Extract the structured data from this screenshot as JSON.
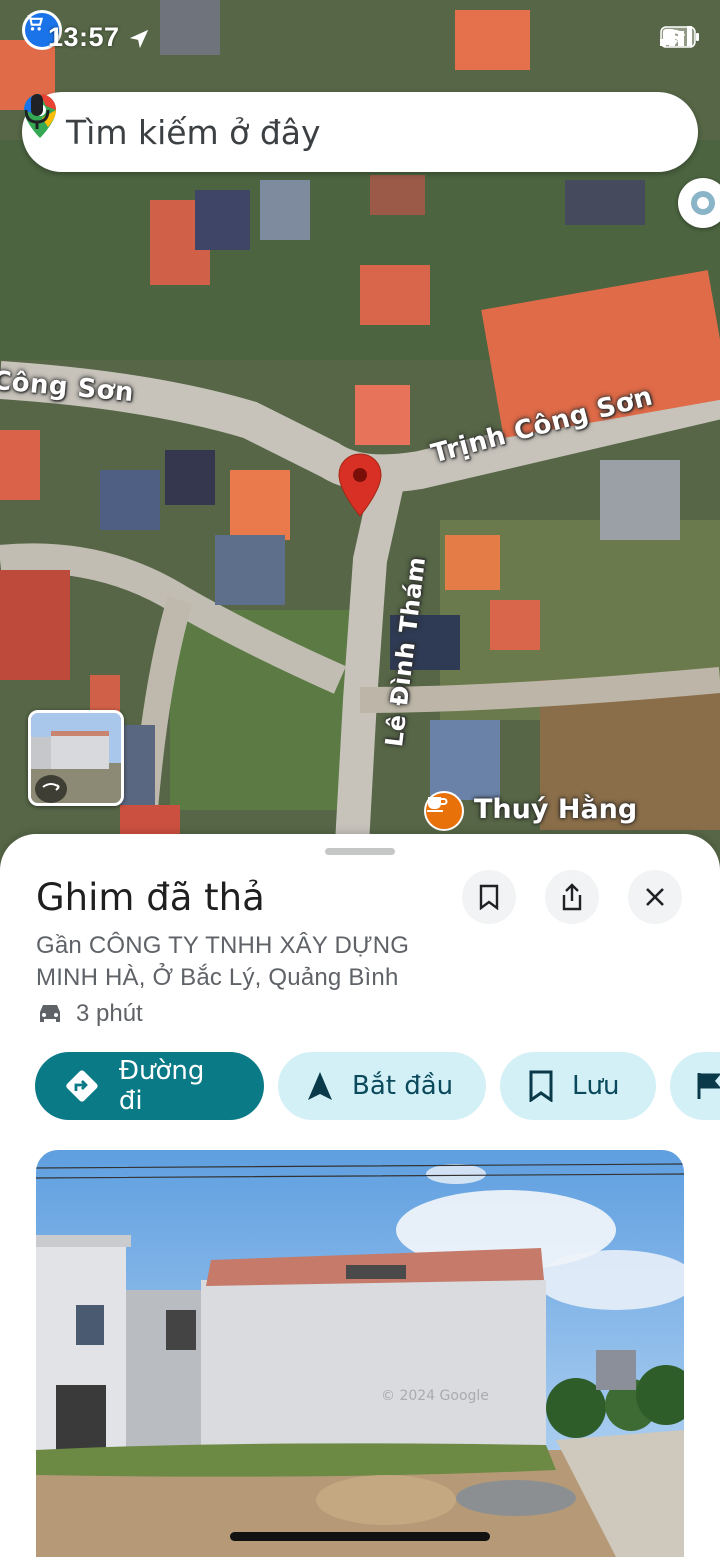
{
  "status_bar": {
    "time": "13:57"
  },
  "search": {
    "placeholder": "Tìm kiếm ở đây"
  },
  "map": {
    "street_labels": [
      "Công Sơn",
      "Trịnh Công Sơn",
      "Lê Đình Thám"
    ],
    "poi": {
      "name": "Thuý Hằng",
      "icon": "cafe-icon",
      "color": "#e8710a"
    },
    "pin_color": "#d93025"
  },
  "place": {
    "title": "Ghim đã thả",
    "address": "Gần CÔNG TY TNHH XÂY DỰNG MINH HÀ, Ở Bắc Lý, Quảng Bình",
    "drive_time": "3 phút"
  },
  "actions": {
    "directions": "Đường đi",
    "start": "Bắt đầu",
    "save": "Lưu"
  },
  "photo": {
    "watermark": "© 2024 Google"
  },
  "colors": {
    "primary": "#0b7a87",
    "secondary_chip": "#d3f0f6"
  }
}
